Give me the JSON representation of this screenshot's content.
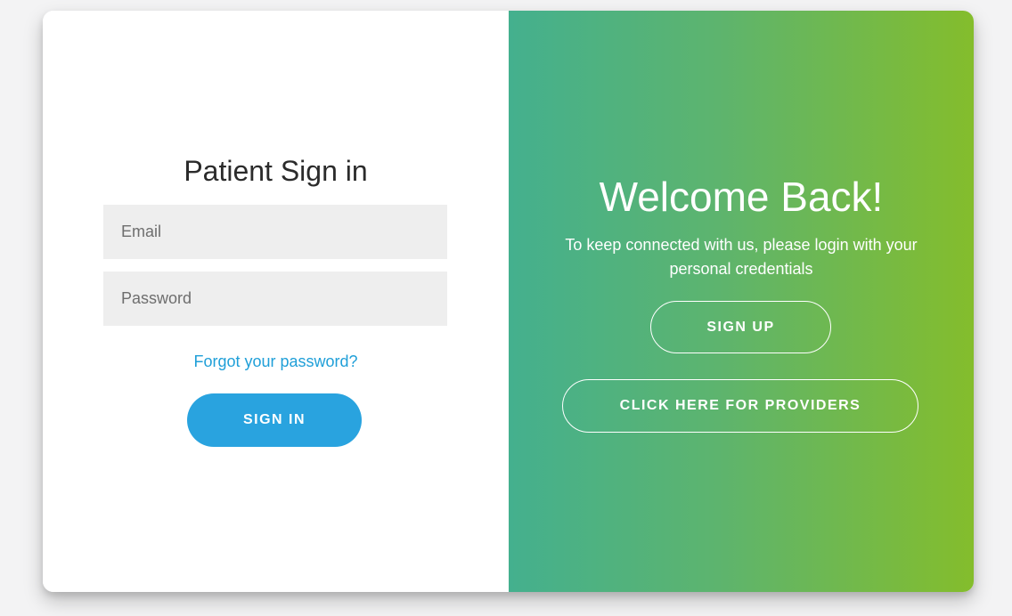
{
  "signin": {
    "title": "Patient Sign in",
    "email_placeholder": "Email",
    "password_placeholder": "Password",
    "forgot_label": "Forgot your password?",
    "submit_label": "SIGN IN"
  },
  "welcome": {
    "title": "Welcome Back!",
    "text": "To keep connected with us, please login with your personal credentials",
    "signup_label": "SIGN UP",
    "providers_label": "CLICK HERE FOR PROVIDERS"
  },
  "colors": {
    "accent_blue": "#29a3df",
    "link_blue": "#1f9fd8",
    "gradient_start": "#44b08e",
    "gradient_end": "#84bd2c"
  }
}
